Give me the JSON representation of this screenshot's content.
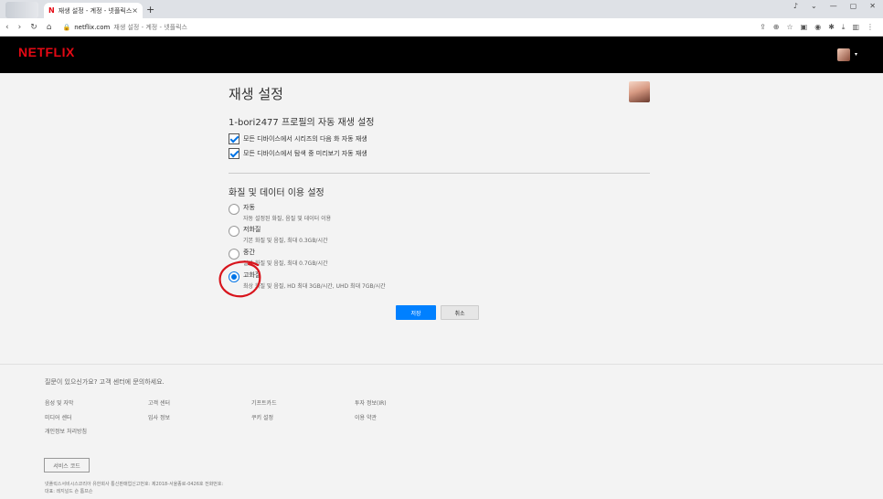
{
  "browser": {
    "tab_title": "재생 설정 - 계정 - 넷플릭스",
    "tab_logo": "N",
    "tab_close": "×",
    "new_tab": "+",
    "url_host": "netflix.com",
    "url_title": "재생 설정 - 계정 - 넷플릭스",
    "window_controls": [
      "♪",
      "⌄",
      "—",
      "▢",
      "✕"
    ],
    "nav": [
      "‹",
      "›",
      "↻",
      "⌂"
    ]
  },
  "header": {
    "logo": "NETFLIX",
    "caret": "▾"
  },
  "page": {
    "title": "재생 설정",
    "autoplay_title": "1-bori2477 프로필의 자동 재생 설정",
    "autoplay_options": [
      {
        "label": "모든 디바이스에서 시리즈의 다음 화 자동 재생",
        "checked": true
      },
      {
        "label": "모든 디바이스에서 탐색 중 미리보기 자동 재생",
        "checked": true
      }
    ],
    "quality_title": "화질 및 데이터 이용 설정",
    "quality_options": [
      {
        "label": "자동",
        "desc": "자동 설정된 화질, 음질 및 데이터 이용",
        "selected": false
      },
      {
        "label": "저화질",
        "desc": "기본 화질 및 음질, 최대 0.3GB/시간",
        "selected": false
      },
      {
        "label": "중간",
        "desc": "일반 화질 및 음질, 최대 0.7GB/시간",
        "selected": false
      },
      {
        "label": "고화질",
        "desc": "최상 화질 및 음질, HD 최대 3GB/시간, UHD 최대 7GB/시간",
        "selected": true
      }
    ],
    "save_label": "저장",
    "cancel_label": "취소"
  },
  "footer": {
    "help": "질문이 있으신가요? 고객 센터에 문의하세요.",
    "links": [
      [
        "음성 및 자막",
        "고객 센터",
        "기프트카드",
        "투자 정보(IR)"
      ],
      [
        "미디어 센터",
        "입사 정보",
        "쿠키 설정",
        "이용 약관"
      ],
      [
        "개인정보 처리방침"
      ]
    ],
    "service_code": "서비스 코드",
    "legal_1": "넷플릭스서비시스코리아 유한회사 통신판매업신고번호: 제2018-서울종로-0426호 전화번호:",
    "legal_2": "대표: 레지널드 숀 톰프슨"
  },
  "colors": {
    "netflix_red": "#e50914",
    "accent_blue": "#0080ff",
    "annotation": "#d8141c"
  }
}
